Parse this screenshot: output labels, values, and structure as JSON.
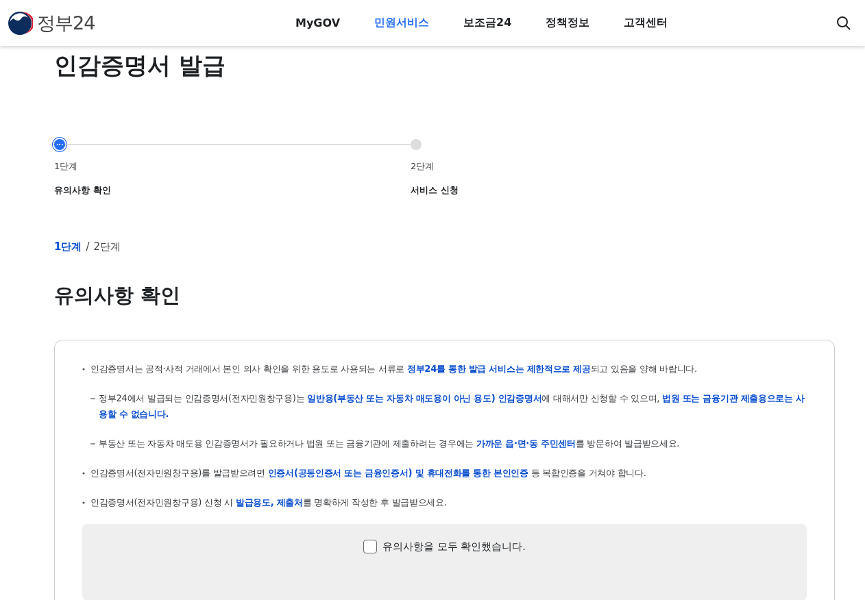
{
  "header": {
    "logo_text": "정부24",
    "nav": [
      {
        "label": "MyGOV",
        "selected": false
      },
      {
        "label": "민원서비스",
        "selected": true
      },
      {
        "label": "보조금24",
        "selected": false
      },
      {
        "label": "정책정보",
        "selected": false
      },
      {
        "label": "고객센터",
        "selected": false
      }
    ]
  },
  "page_title": "인감증명서 발급",
  "steps": [
    {
      "number": "1단계",
      "label": "유의사항 확인",
      "current": true
    },
    {
      "number": "2단계",
      "label": "서비스 신청",
      "current": false
    }
  ],
  "breadcrumb": [
    {
      "label": "1단계",
      "selected": true
    },
    {
      "label": "2단계",
      "selected": false
    }
  ],
  "breadcrumb_separator": "/",
  "section_title": "유의사항 확인",
  "notices": [
    {
      "kind": "bullet",
      "text": "인감증명서는 공적·사적 거래에서 본인 의사 확인을 위한 용도로 사용되는 서류로 **정부24를 통한 발급 서비스는 제한적으로 제공**되고 있음을 양해 바랍니다."
    },
    {
      "kind": "dash",
      "text": "정부24에서 발급되는 인감증명서(전자민원창구용)는 **일반용(부동산 또는 자동차 매도용이 아닌 용도) 인감증명서**에 대해서만 신청할 수 있으며, **법원 또는 금융기관 제출용으로는 사용할 수 없습니다.**"
    },
    {
      "kind": "dash",
      "text": "부동산 또는 자동차 매도용 인감증명서가 필요하거나 법원 또는 금융기관에 제출하려는 경우에는 **가까운 읍·면·동 주민센터**를 방문하여 발급받으세요."
    },
    {
      "kind": "bullet",
      "text": "인감증명서(전자민원창구용)를 발급받으려면 **인증서(공동인증서 또는 금융인증서) 및 휴대전화를 통한 본인인증** 등 복합인증을 거쳐야 합니다."
    },
    {
      "kind": "bullet",
      "text": "인감증명서(전자민원창구용) 신청 시 **발급용도, 제출처**를 명확하게 작성한 후 발급받으세요."
    }
  ],
  "confirm": {
    "label": "유의사항을 모두 확인했습니다.",
    "checked": false
  }
}
